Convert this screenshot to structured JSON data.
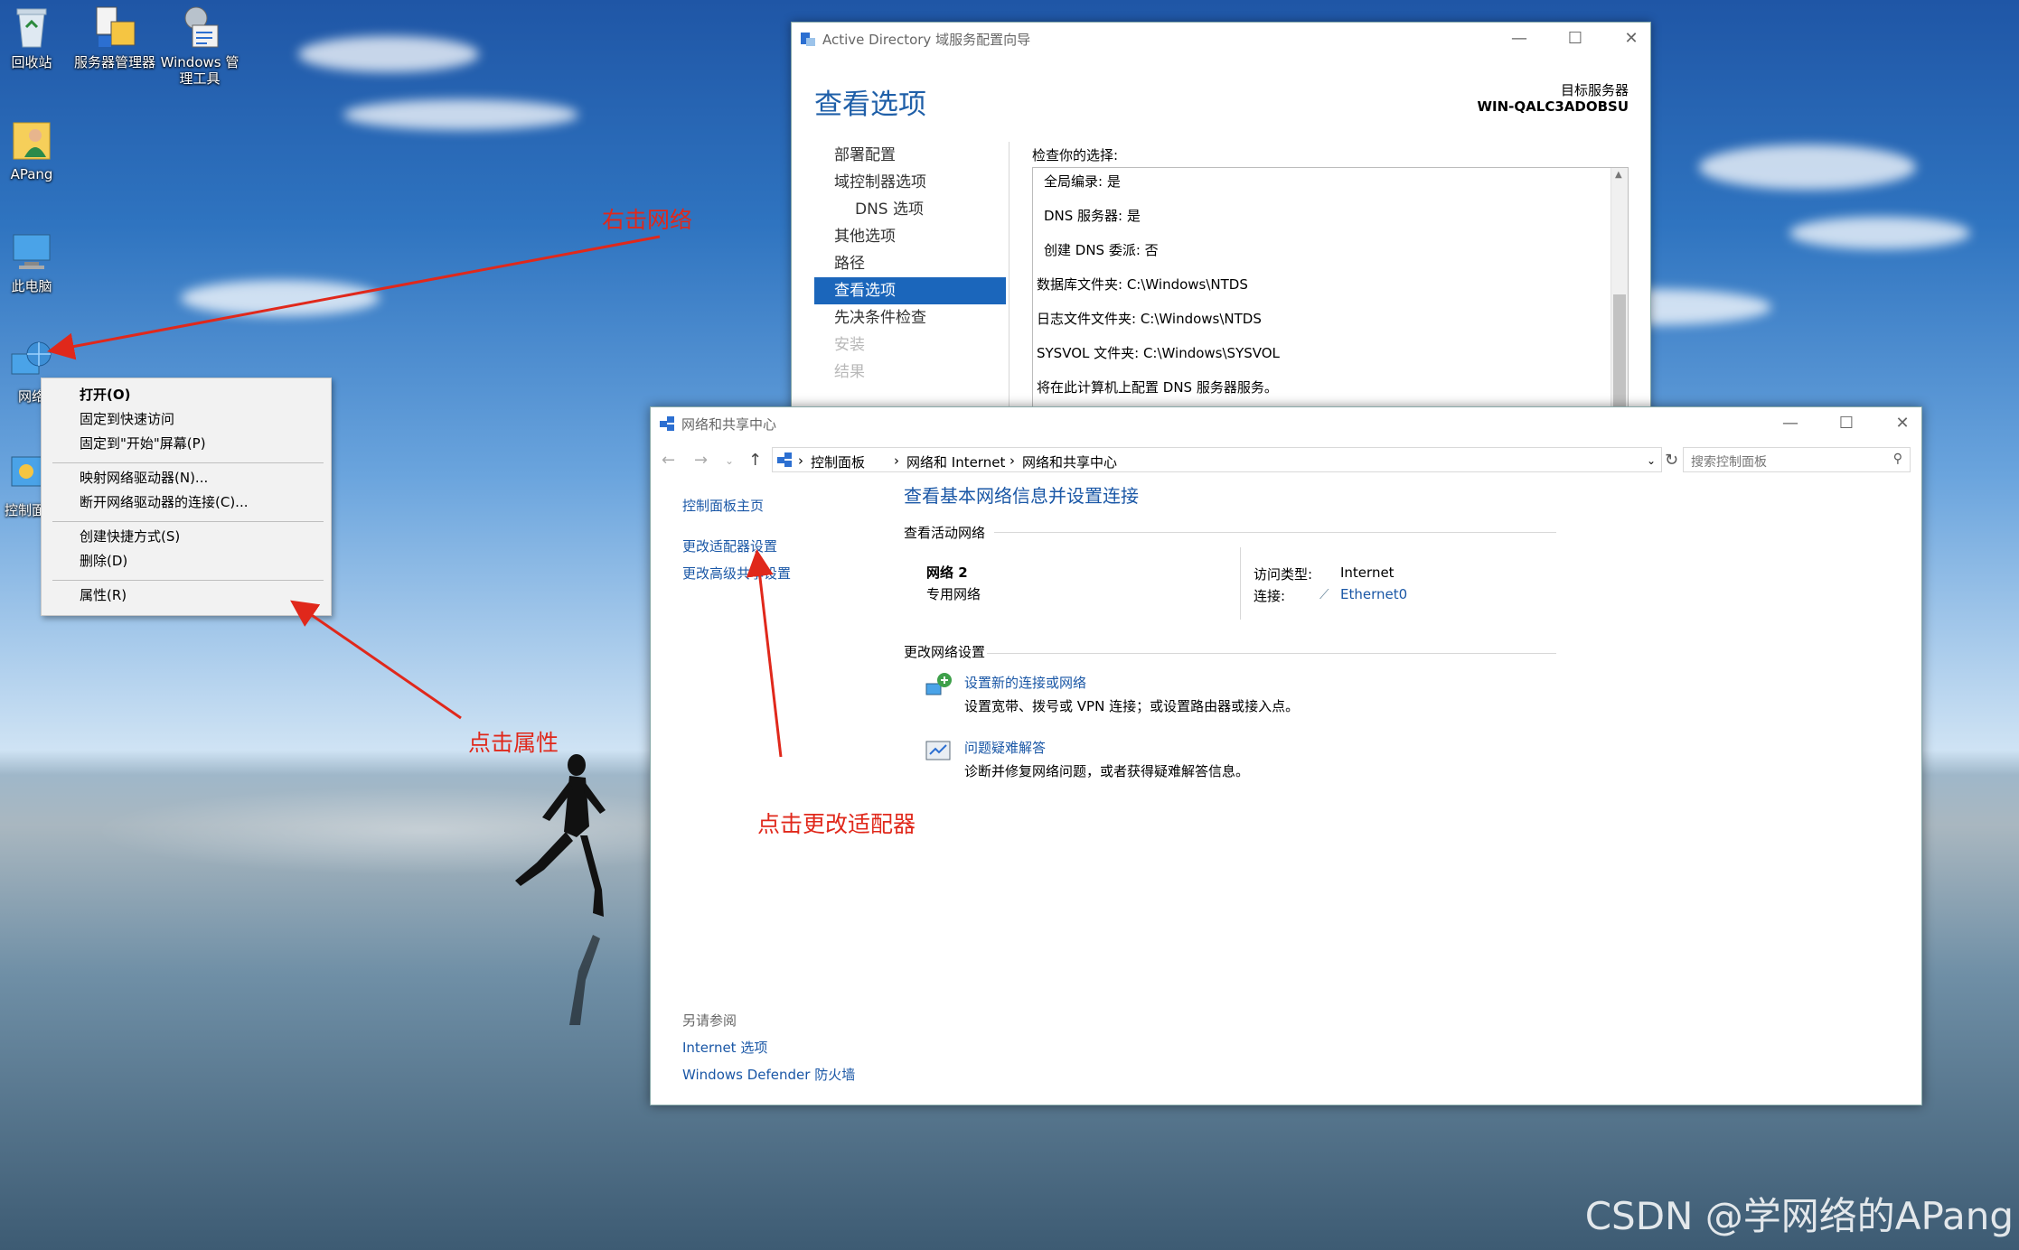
{
  "desktop": {
    "icons": [
      {
        "label": "回收站"
      },
      {
        "label": "服务器管理器"
      },
      {
        "label": "Windows 管理工具"
      },
      {
        "label": "APang"
      },
      {
        "label": "此电脑"
      },
      {
        "label": "网络"
      },
      {
        "label": "控制面板"
      }
    ],
    "watermark": "CSDN @学网络的APang"
  },
  "context_menu": {
    "items": [
      {
        "label": "打开(O)"
      },
      {
        "label": "固定到快速访问"
      },
      {
        "label": "固定到\"开始\"屏幕(P)"
      },
      {
        "label": "映射网络驱动器(N)..."
      },
      {
        "label": "断开网络驱动器的连接(C)..."
      },
      {
        "label": "创建快捷方式(S)"
      },
      {
        "label": "删除(D)"
      },
      {
        "label": "属性(R)"
      }
    ]
  },
  "ad_window": {
    "title": "Active Directory 域服务配置向导",
    "heading": "查看选项",
    "target_label": "目标服务器",
    "target_value": "WIN-QALC3ADOBSU",
    "nav": [
      {
        "label": "部署配置"
      },
      {
        "label": "域控制器选项"
      },
      {
        "label": "DNS 选项"
      },
      {
        "label": "其他选项"
      },
      {
        "label": "路径"
      },
      {
        "label": "查看选项"
      },
      {
        "label": "先决条件检查"
      },
      {
        "label": "安装"
      },
      {
        "label": "结果"
      }
    ],
    "review_label": "检查你的选择:",
    "review_lines": [
      "全局编录: 是",
      "DNS 服务器: 是",
      "创建 DNS 委派: 否",
      "数据库文件夹: C:\\Windows\\NTDS",
      "日志文件文件夹: C:\\Windows\\NTDS",
      "SYSVOL 文件夹: C:\\Windows\\SYSVOL",
      "将在此计算机上配置 DNS 服务器服务。"
    ]
  },
  "net_window": {
    "title": "网络和共享中心",
    "breadcrumb": [
      "控制面板",
      "网络和 Internet",
      "网络和共享中心"
    ],
    "search_placeholder": "搜索控制面板",
    "left_links": [
      "控制面板主页",
      "更改适配器设置",
      "更改高级共享设置"
    ],
    "see_also_label": "另请参阅",
    "see_also_links": [
      "Internet 选项",
      "Windows Defender 防火墙"
    ],
    "main_title": "查看基本网络信息并设置连接",
    "active_section": "查看活动网络",
    "network_name": "网络 2",
    "network_type": "专用网络",
    "access_type_label": "访问类型:",
    "access_type_value": "Internet",
    "connection_label": "连接:",
    "connection_value": "Ethernet0",
    "change_section": "更改网络设置",
    "tasks": [
      {
        "title": "设置新的连接或网络",
        "desc": "设置宽带、拨号或 VPN 连接；或设置路由器或接入点。"
      },
      {
        "title": "问题疑难解答",
        "desc": "诊断并修复网络问题，或者获得疑难解答信息。"
      }
    ]
  },
  "annotations": [
    "右击网络",
    "点击属性",
    "点击更改适配器"
  ],
  "colors": {
    "accent": "#1b66bb",
    "link": "#1a57a6",
    "annotation": "#e0281b"
  }
}
